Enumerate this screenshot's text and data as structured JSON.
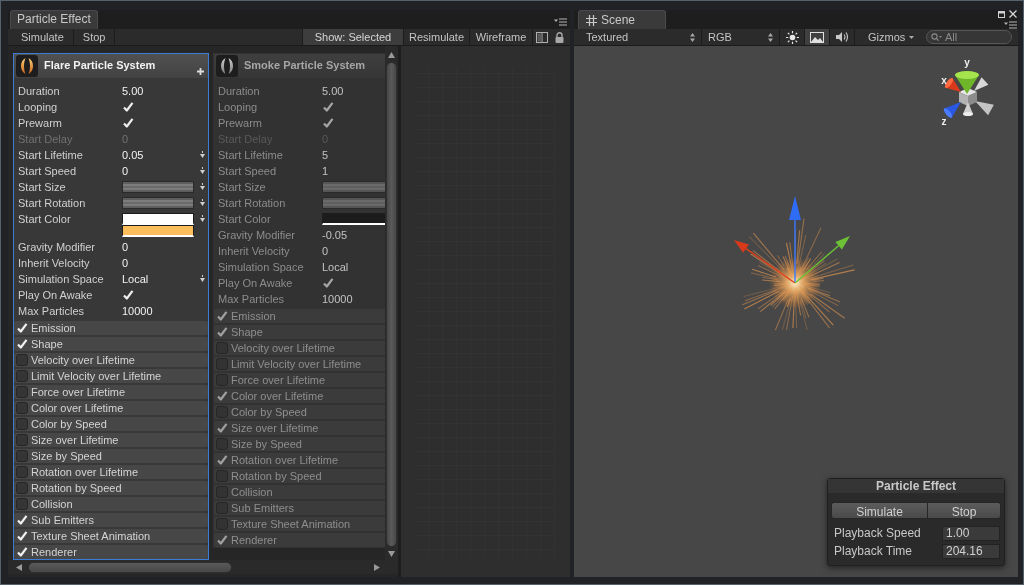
{
  "particle_effect_window": {
    "tab": {
      "label": "Particle Effect"
    },
    "toolbar": {
      "left_buttons": [
        {
          "label": "Simulate"
        },
        {
          "label": "Stop"
        }
      ],
      "right_buttons": [
        {
          "label": "Show: Selected",
          "on": true
        },
        {
          "label": "Resimulate",
          "on": false
        },
        {
          "label": "Wireframe",
          "on": false
        }
      ]
    },
    "systems": [
      {
        "name": "Flare Particle System",
        "kind": "flare",
        "selected": true,
        "properties": [
          {
            "label": "Duration",
            "kind": "value",
            "value": "5.00",
            "disabled": false,
            "dropdown": false
          },
          {
            "label": "Looping",
            "kind": "toggle",
            "checked": true,
            "disabled": false,
            "dropdown": false
          },
          {
            "label": "Prewarm",
            "kind": "toggle",
            "checked": true,
            "disabled": false,
            "dropdown": false
          },
          {
            "label": "Start Delay",
            "kind": "value",
            "value": "0",
            "disabled": true,
            "dropdown": false
          },
          {
            "label": "Start Lifetime",
            "kind": "value",
            "value": "0.05",
            "disabled": false,
            "dropdown": true
          },
          {
            "label": "Start Speed",
            "kind": "value",
            "value": "0",
            "disabled": false,
            "dropdown": true
          },
          {
            "label": "Start Size",
            "kind": "curve",
            "disabled": false,
            "dropdown": true
          },
          {
            "label": "Start Rotation",
            "kind": "curve",
            "disabled": false,
            "dropdown": true
          },
          {
            "label": "Start Color",
            "kind": "color",
            "swatches": [
              {
                "color": "#ffffff"
              },
              {
                "color": "#fcbd5c"
              }
            ],
            "disabled": false,
            "dropdown": true
          },
          {
            "label": "Gravity Modifier",
            "kind": "value",
            "value": "0",
            "disabled": false,
            "dropdown": false
          },
          {
            "label": "Inherit Velocity",
            "kind": "value",
            "value": "0",
            "disabled": false,
            "dropdown": false
          },
          {
            "label": "Simulation Space",
            "kind": "value",
            "value": "Local",
            "disabled": false,
            "dropdown": true
          },
          {
            "label": "Play On Awake",
            "kind": "toggle",
            "checked": true,
            "disabled": false,
            "dropdown": false
          },
          {
            "label": "Max Particles",
            "kind": "value",
            "value": "10000",
            "disabled": false,
            "dropdown": false
          }
        ],
        "modules": [
          {
            "label": "Emission",
            "checked": true
          },
          {
            "label": "Shape",
            "checked": true
          },
          {
            "label": "Velocity over Lifetime",
            "checked": false
          },
          {
            "label": "Limit Velocity over Lifetime",
            "checked": false
          },
          {
            "label": "Force over Lifetime",
            "checked": false
          },
          {
            "label": "Color over Lifetime",
            "checked": false
          },
          {
            "label": "Color by Speed",
            "checked": false
          },
          {
            "label": "Size over Lifetime",
            "checked": false
          },
          {
            "label": "Size by Speed",
            "checked": false
          },
          {
            "label": "Rotation over Lifetime",
            "checked": false
          },
          {
            "label": "Rotation by Speed",
            "checked": false
          },
          {
            "label": "Collision",
            "checked": false
          },
          {
            "label": "Sub Emitters",
            "checked": true
          },
          {
            "label": "Texture Sheet Animation",
            "checked": true
          },
          {
            "label": "Renderer",
            "checked": true
          }
        ]
      },
      {
        "name": "Smoke Particle System",
        "kind": "smoke",
        "selected": false,
        "properties": [
          {
            "label": "Duration",
            "kind": "value",
            "value": "5.00",
            "disabled": false,
            "dropdown": false
          },
          {
            "label": "Looping",
            "kind": "toggle",
            "checked": true,
            "disabled": false,
            "dropdown": false
          },
          {
            "label": "Prewarm",
            "kind": "toggle",
            "checked": true,
            "disabled": false,
            "dropdown": false
          },
          {
            "label": "Start Delay",
            "kind": "value",
            "value": "0",
            "disabled": true,
            "dropdown": false
          },
          {
            "label": "Start Lifetime",
            "kind": "value",
            "value": "5",
            "disabled": false,
            "dropdown": false
          },
          {
            "label": "Start Speed",
            "kind": "value",
            "value": "1",
            "disabled": false,
            "dropdown": false
          },
          {
            "label": "Start Size",
            "kind": "curve",
            "disabled": false,
            "dropdown": false
          },
          {
            "label": "Start Rotation",
            "kind": "curve",
            "disabled": false,
            "dropdown": false
          },
          {
            "label": "Start Color",
            "kind": "color",
            "swatches": [
              {
                "color": "#1c1c1c"
              }
            ],
            "disabled": false,
            "dropdown": false
          },
          {
            "label": "Gravity Modifier",
            "kind": "value",
            "value": "-0.05",
            "disabled": false,
            "dropdown": false
          },
          {
            "label": "Inherit Velocity",
            "kind": "value",
            "value": "0",
            "disabled": false,
            "dropdown": false
          },
          {
            "label": "Simulation Space",
            "kind": "value",
            "value": "Local",
            "disabled": false,
            "dropdown": false
          },
          {
            "label": "Play On Awake",
            "kind": "toggle",
            "checked": true,
            "disabled": false,
            "dropdown": false
          },
          {
            "label": "Max Particles",
            "kind": "value",
            "value": "10000",
            "disabled": false,
            "dropdown": false
          }
        ],
        "modules": [
          {
            "label": "Emission",
            "checked": true
          },
          {
            "label": "Shape",
            "checked": true
          },
          {
            "label": "Velocity over Lifetime",
            "checked": false
          },
          {
            "label": "Limit Velocity over Lifetime",
            "checked": false
          },
          {
            "label": "Force over Lifetime",
            "checked": false
          },
          {
            "label": "Color over Lifetime",
            "checked": true
          },
          {
            "label": "Color by Speed",
            "checked": false
          },
          {
            "label": "Size over Lifetime",
            "checked": true
          },
          {
            "label": "Size by Speed",
            "checked": false
          },
          {
            "label": "Rotation over Lifetime",
            "checked": true
          },
          {
            "label": "Rotation by Speed",
            "checked": false
          },
          {
            "label": "Collision",
            "checked": false
          },
          {
            "label": "Sub Emitters",
            "checked": false
          },
          {
            "label": "Texture Sheet Animation",
            "checked": false
          },
          {
            "label": "Renderer",
            "checked": true
          }
        ]
      }
    ]
  },
  "scene_window": {
    "tab": {
      "label": "Scene"
    },
    "toolbar": {
      "render_mode": {
        "label": "Textured"
      },
      "channel": {
        "label": "RGB"
      },
      "toggles": [
        {
          "kind": "sun",
          "on": false
        },
        {
          "kind": "image",
          "on": true
        },
        {
          "kind": "audio",
          "on": false
        }
      ],
      "gizmos": {
        "label": "Gizmos"
      },
      "search": {
        "placeholder": "All"
      }
    },
    "orientation_gizmo": {
      "axes": [
        {
          "kind": "y",
          "label": "y"
        },
        {
          "kind": "x",
          "label": "x"
        },
        {
          "kind": "z",
          "label": "z"
        }
      ]
    },
    "overlay": {
      "title": "Particle Effect",
      "buttons": [
        {
          "label": "Simulate"
        },
        {
          "label": "Stop"
        }
      ],
      "fields": [
        {
          "label": "Playback Speed",
          "value": "1.00"
        },
        {
          "label": "Playback Time",
          "value": "204.16"
        }
      ]
    }
  }
}
